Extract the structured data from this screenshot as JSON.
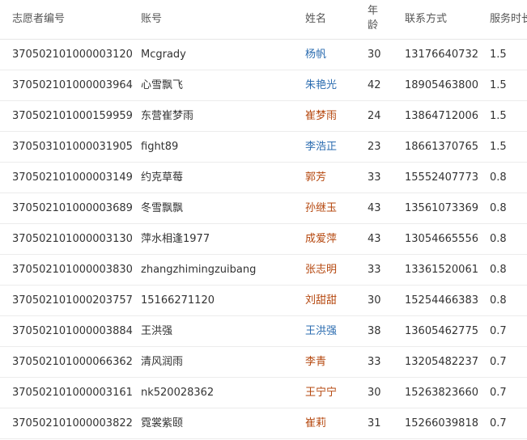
{
  "headers": {
    "volunteer_id": "志愿者编号",
    "account": "账号",
    "name": "姓名",
    "age_line1": "年",
    "age_line2": "龄",
    "contact": "联系方式",
    "service_hours": "服务时长"
  },
  "colors": {
    "name_blue": "#2b6cb0",
    "name_red": "#b5470e"
  },
  "rows": [
    {
      "id": "370502101000003120",
      "account": "Mcgrady",
      "name": "杨帆",
      "name_color": "blue",
      "age": "30",
      "phone": "13176640732",
      "hours": "1.5"
    },
    {
      "id": "370502101000003964",
      "account": "心雪飘飞",
      "name": "朱艳光",
      "name_color": "blue",
      "age": "42",
      "phone": "18905463800",
      "hours": "1.5"
    },
    {
      "id": "370502101000159959",
      "account": "东营崔梦雨",
      "name": "崔梦雨",
      "name_color": "red",
      "age": "24",
      "phone": "13864712006",
      "hours": "1.5"
    },
    {
      "id": "370503101000031905",
      "account": "fight89",
      "name": "李浩正",
      "name_color": "blue",
      "age": "23",
      "phone": "18661370765",
      "hours": "1.5"
    },
    {
      "id": "370502101000003149",
      "account": "约克草莓",
      "name": "郭芳",
      "name_color": "red",
      "age": "33",
      "phone": "15552407773",
      "hours": "0.8"
    },
    {
      "id": "370502101000003689",
      "account": "冬雪飘飘",
      "name": "孙继玉",
      "name_color": "red",
      "age": "43",
      "phone": "13561073369",
      "hours": "0.8"
    },
    {
      "id": "370502101000003130",
      "account": "萍水相逢1977",
      "name": "成爱萍",
      "name_color": "red",
      "age": "43",
      "phone": "13054665556",
      "hours": "0.8"
    },
    {
      "id": "370502101000003830",
      "account": "zhangzhimingzuibang",
      "name": "张志明",
      "name_color": "red",
      "age": "33",
      "phone": "13361520061",
      "hours": "0.8"
    },
    {
      "id": "370502101000203757",
      "account": "15166271120",
      "name": "刘甜甜",
      "name_color": "red",
      "age": "30",
      "phone": "15254466383",
      "hours": "0.8"
    },
    {
      "id": "370502101000003884",
      "account": "王洪强",
      "name": "王洪强",
      "name_color": "blue",
      "age": "38",
      "phone": "13605462775",
      "hours": "0.7"
    },
    {
      "id": "370502101000066362",
      "account": "清风润雨",
      "name": "李青",
      "name_color": "red",
      "age": "33",
      "phone": "13205482237",
      "hours": "0.7"
    },
    {
      "id": "370502101000003161",
      "account": "nk520028362",
      "name": "王宁宁",
      "name_color": "red",
      "age": "30",
      "phone": "15263823660",
      "hours": "0.7"
    },
    {
      "id": "370502101000003822",
      "account": "霓裳紫颐",
      "name": "崔莉",
      "name_color": "red",
      "age": "31",
      "phone": "15266039818",
      "hours": "0.7"
    }
  ]
}
